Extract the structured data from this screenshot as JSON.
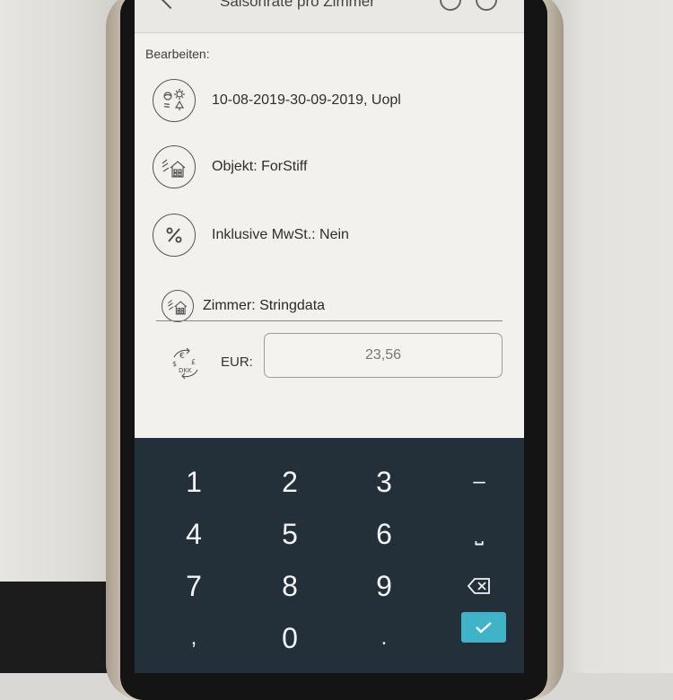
{
  "header": {
    "title": "Saisonrate pro Zimmer"
  },
  "section_label": "Bearbeiten:",
  "rows": [
    {
      "icon": "season-weather-icon",
      "text": "10-08-2019-30-09-2019, Uopl"
    },
    {
      "icon": "property-house-icon",
      "text": "Objekt: ForStiff"
    },
    {
      "icon": "percent-icon",
      "text": "Inklusive MwSt.: Nein"
    }
  ],
  "zimmer": {
    "icon": "room-house-icon",
    "text": "Zimmer: Stringdata"
  },
  "price": {
    "icon": "currency-exchange-icon",
    "label": "EUR:",
    "value": "23,56"
  },
  "keypad": {
    "keys": [
      [
        "1",
        "2",
        "3",
        "–"
      ],
      [
        "4",
        "5",
        "6",
        "␣"
      ],
      [
        "7",
        "8",
        "9",
        "backspace"
      ],
      [
        ",",
        "0",
        ".",
        "done"
      ]
    ],
    "space_symbol": "⎵",
    "done_symbol": "✓"
  },
  "colors": {
    "keypad_bg": "#243039",
    "accent": "#3fb4c9",
    "screen_bg": "#f2f1ee"
  }
}
